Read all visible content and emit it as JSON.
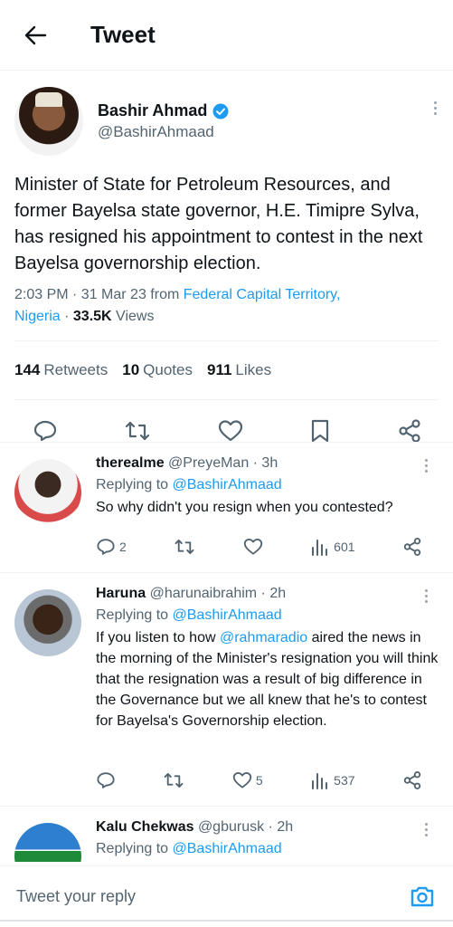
{
  "header": {
    "title": "Tweet",
    "back_icon": "arrow-left-icon"
  },
  "tweet": {
    "author_name": "Bashir Ahmad",
    "author_handle": "@BashirAhmaad",
    "verified_icon": "verified-badge-icon",
    "text": "Minister of State for Petroleum Resources, and former Bayelsa state governor, H.E. Timipre Sylva, has resigned his appointment to contest in the next Bayelsa governorship election.",
    "time": "2:03 PM · 31 Mar 23 from ",
    "location_line1": "Federal Capital Territory,",
    "location_line2": "Nigeria",
    "views_sep": " · ",
    "views_count": "33.5K",
    "views_label": " Views",
    "retweets_count": "144",
    "retweets_label": "Retweets",
    "quotes_count": "10",
    "quotes_label": "Quotes",
    "likes_count": "911",
    "likes_label": "Likes"
  },
  "replies": [
    {
      "name": "therealme",
      "handle": "@PreyeMan · 3h",
      "replying_prefix": "Replying to ",
      "replying_to": "@BashirAhmaad",
      "text": "So why didn't you resign when you contested?",
      "reply_count": "2",
      "retweet_count": "",
      "like_count": "",
      "views": "601"
    },
    {
      "name": "Haruna",
      "handle": "@harunaibrahim · 2h",
      "replying_prefix": "Replying to ",
      "replying_to": "@BashirAhmaad",
      "text_prefix": "If you listen to how ",
      "text_mention": "@rahmaradio",
      "text_rest": " aired the news in the morning of the Minister's resignation you will think that the resignation was a result of big difference in the Governance but we all knew that he's to contest for Bayelsa's Governorship election.",
      "reply_count": "",
      "retweet_count": "",
      "like_count": "5",
      "views": "537"
    },
    {
      "name": "Kalu Chekwas",
      "handle": "@gburusk · 2h",
      "replying_prefix": "Replying to ",
      "replying_to": "@BashirAhmaad"
    }
  ],
  "composer": {
    "placeholder": "Tweet your reply",
    "camera_icon": "camera-icon"
  },
  "colors": {
    "accent": "#1d9bf0",
    "text": "#0f1419",
    "muted": "#536471"
  }
}
